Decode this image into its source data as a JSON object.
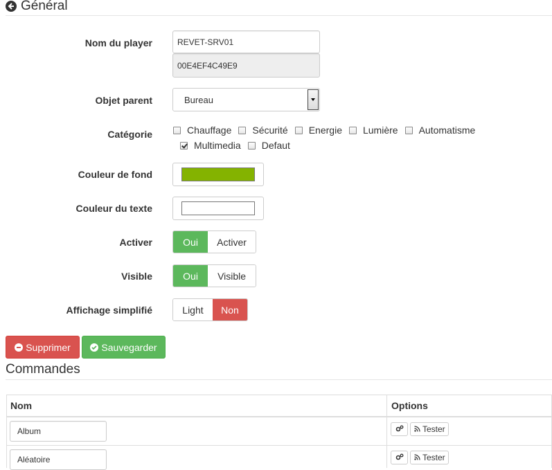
{
  "header": {
    "title": "Général",
    "icon": "circle-arrow-left-icon"
  },
  "form": {
    "name_label": "Nom du player",
    "name_value": "REVET-SRV01",
    "id_value": "00E4EF4C49E9",
    "parent_label": "Objet parent",
    "parent_value": "Bureau",
    "category_label": "Catégorie",
    "categories": [
      {
        "label": "Chauffage",
        "checked": false
      },
      {
        "label": "Sécurité",
        "checked": false
      },
      {
        "label": "Energie",
        "checked": false
      },
      {
        "label": "Lumière",
        "checked": false
      },
      {
        "label": "Automatisme",
        "checked": false
      },
      {
        "label": "Multimedia",
        "checked": true
      },
      {
        "label": "Defaut",
        "checked": false
      }
    ],
    "bg_color_label": "Couleur de fond",
    "bg_color_value": "#84b300",
    "text_color_label": "Couleur du texte",
    "text_color_value": "#ffffff",
    "activate_label": "Activer",
    "activate_on": "Oui",
    "activate_off": "Activer",
    "visible_label": "Visible",
    "visible_on": "Oui",
    "visible_off": "Visible",
    "simplified_label": "Affichage simplifié",
    "simplified_on": "Light",
    "simplified_off": "Non"
  },
  "actions": {
    "delete": "Supprimer",
    "save": "Sauvegarder"
  },
  "commands": {
    "title": "Commandes",
    "columns": {
      "name": "Nom",
      "options": "Options"
    },
    "rows": [
      {
        "name": "Album",
        "test": "Tester"
      },
      {
        "name": "Aléatoire",
        "test": "Tester"
      }
    ]
  },
  "colors": {
    "success": "#5cb85c",
    "danger": "#d9534f"
  }
}
